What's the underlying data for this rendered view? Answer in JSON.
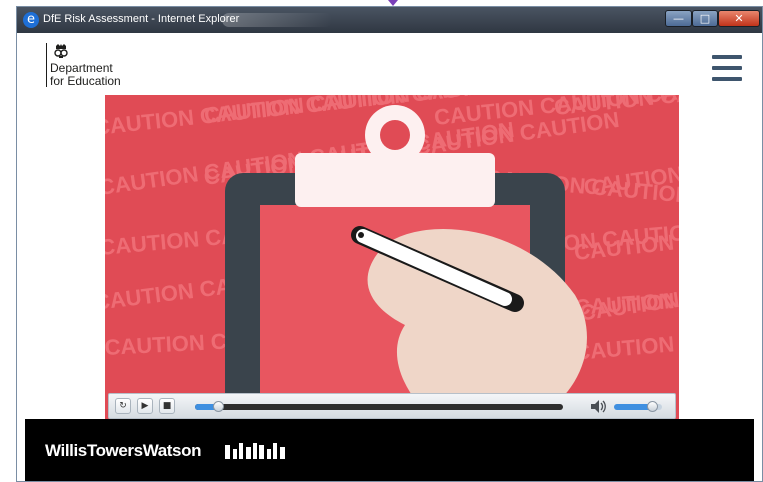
{
  "window": {
    "title": "DfE Risk Assessment - Internet Explorer",
    "app_icon": "ie-icon",
    "buttons": {
      "minimize": "minimize-icon",
      "maximize": "maximize-icon",
      "close": "close-icon"
    }
  },
  "header": {
    "logo_line1": "Department",
    "logo_line2": "for Education",
    "logo_icon": "royal-crest-icon",
    "menu_icon": "hamburger-icon"
  },
  "video": {
    "background_text": "CAUTION",
    "colors": {
      "tape": "#e04b55",
      "clipboard": "#3a444c",
      "paper": "#fdf0f0",
      "pen": "#ffffff"
    },
    "player": {
      "progress_fraction": 0.05,
      "volume_fraction": 0.8,
      "icons": [
        "replay-icon",
        "play-icon",
        "stop-icon",
        "volume-icon"
      ]
    }
  },
  "footer": {
    "brand": "WillisTowersWatson",
    "brand_mark": "wtw-bars-logo-icon",
    "background": "#000000"
  }
}
